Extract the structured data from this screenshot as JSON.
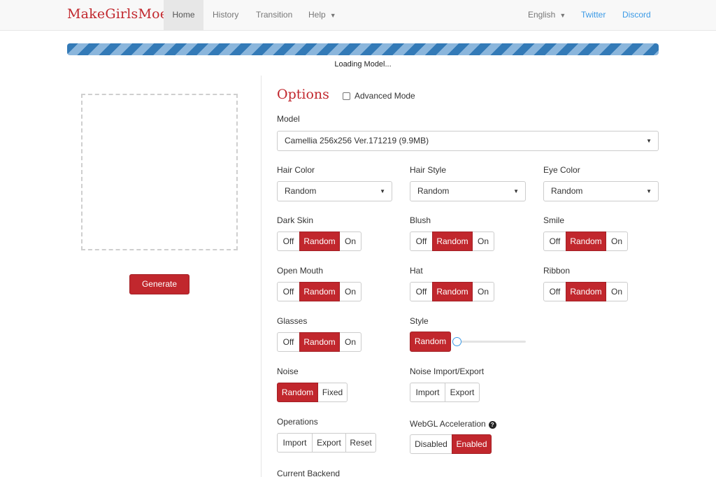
{
  "nav": {
    "brand": "MakeGirlsMoe",
    "items": [
      {
        "label": "Home",
        "active": true
      },
      {
        "label": "History"
      },
      {
        "label": "Transition"
      },
      {
        "label": "Help"
      }
    ],
    "language": "English",
    "twitter": "Twitter",
    "discord": "Discord",
    "caret": "▼"
  },
  "progress": {
    "status": "Loading Model...",
    "fraction": 1.0
  },
  "left": {
    "generate_label": "Generate"
  },
  "options": {
    "title": "Options",
    "advanced_mode_label": "Advanced Mode",
    "model": {
      "label": "Model",
      "value": "Camellia 256x256 Ver.171219 (9.9MB)"
    },
    "hair_color": {
      "label": "Hair Color",
      "value": "Random"
    },
    "hair_style": {
      "label": "Hair Style",
      "value": "Random"
    },
    "eye_color": {
      "label": "Eye Color",
      "value": "Random"
    },
    "tri_options": [
      "Off",
      "Random",
      "On"
    ],
    "dark_skin": {
      "label": "Dark Skin",
      "selected": "Random"
    },
    "blush": {
      "label": "Blush",
      "selected": "Random"
    },
    "smile": {
      "label": "Smile",
      "selected": "Random"
    },
    "open_mouth": {
      "label": "Open Mouth",
      "selected": "Random"
    },
    "hat": {
      "label": "Hat",
      "selected": "Random"
    },
    "ribbon": {
      "label": "Ribbon",
      "selected": "Random"
    },
    "glasses": {
      "label": "Glasses",
      "selected": "Random"
    },
    "style": {
      "label": "Style",
      "button": "Random",
      "slider_value": 0
    },
    "noise": {
      "label": "Noise",
      "options": [
        "Random",
        "Fixed"
      ],
      "selected": "Random"
    },
    "noise_io": {
      "label": "Noise Import/Export",
      "options": [
        "Import",
        "Export"
      ]
    },
    "operations": {
      "label": "Operations",
      "options": [
        "Import",
        "Export",
        "Reset"
      ]
    },
    "webgl": {
      "label": "WebGL Acceleration",
      "help": "?",
      "options": [
        "Disabled",
        "Enabled"
      ],
      "selected": "Enabled"
    },
    "current_backend": {
      "label": "Current Backend"
    }
  },
  "colors": {
    "accent": "#c1272d",
    "link": "#3b9ae6",
    "progress": "#337ab7"
  }
}
